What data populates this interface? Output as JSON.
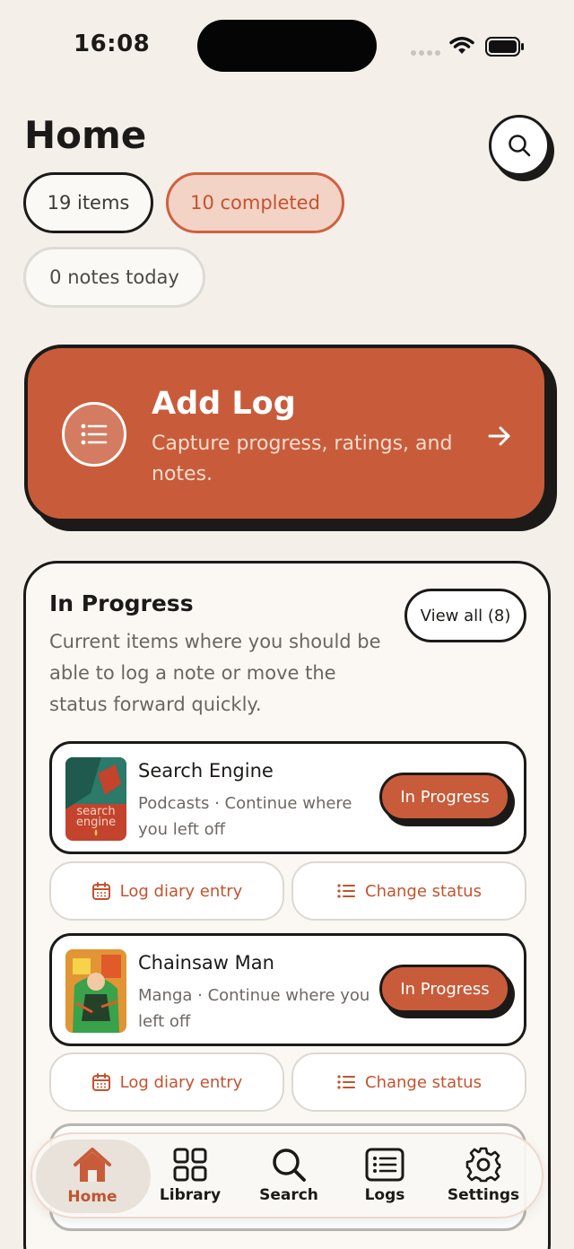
{
  "status_bar": {
    "time": "16:08"
  },
  "header": {
    "title": "Home"
  },
  "stats": {
    "items": "19 items",
    "completed": "10 completed",
    "notes": "0 notes today"
  },
  "add_log": {
    "title": "Add Log",
    "subtitle": "Capture progress, ratings, and notes."
  },
  "in_progress": {
    "title": "In Progress",
    "description": "Current items where you should be able to log a note or move the status forward quickly.",
    "view_all": "View all (8)",
    "items": [
      {
        "title": "Search Engine",
        "meta": "Podcasts · Continue where you left off",
        "status": "In Progress",
        "cover_text": "search engine",
        "log_label": "Log diary entry",
        "change_label": "Change status"
      },
      {
        "title": "Chainsaw Man",
        "meta": "Manga · Continue where you left off",
        "status": "In Progress",
        "log_label": "Log diary entry",
        "change_label": "Change status"
      }
    ]
  },
  "tabbar": {
    "tabs": [
      {
        "label": "Home",
        "icon": "home-icon"
      },
      {
        "label": "Library",
        "icon": "grid-icon"
      },
      {
        "label": "Search",
        "icon": "search-icon"
      },
      {
        "label": "Logs",
        "icon": "list-icon"
      },
      {
        "label": "Settings",
        "icon": "gear-icon"
      }
    ]
  },
  "colors": {
    "background": "#f4efe9",
    "accent": "#c85c3a",
    "ink": "#1c1a18"
  }
}
